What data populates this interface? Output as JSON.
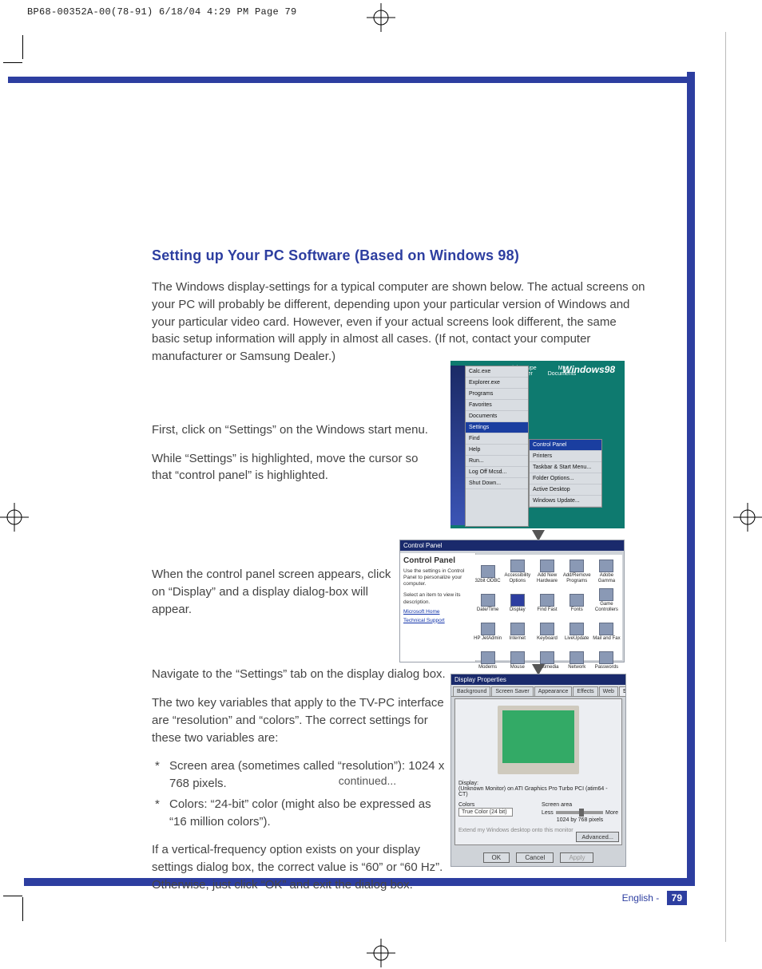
{
  "slug": "BP68-00352A-00(78-91)  6/18/04  4:29 PM  Page 79",
  "title": "Setting up Your PC Software (Based on Windows 98)",
  "intro": "The Windows display-settings for a typical computer are shown below. The actual screens on your PC will probably be different, depending upon your particular version of Windows and your particular video card. However, even if your actual screens look different, the same basic setup information will apply in almost all cases. (If not, contact your computer manufacturer or Samsung Dealer.)",
  "step1a": "First, click on “Settings” on the Windows start menu.",
  "step1b": "While “Settings” is highlighted, move the cursor so that  “control panel” is highlighted.",
  "step2": "When the control panel screen appears, click on “Display” and a display dialog-box will appear.",
  "step3a": "Navigate to the “Settings” tab on the display dialog box.",
  "step3b": "The two key variables that apply to the TV-PC interface are “resolution” and “colors”. The correct settings for these two variables are:",
  "step3_b1": "Screen area (sometimes called “resolution”): 1024 x 768 pixels.",
  "step3_b2": "Colors: “24-bit” color (might also be expressed as “16 million colors”).",
  "step3c": "If a vertical-frequency option exists on your display settings dialog box, the correct value is “60” or “60 Hz”. Otherwise, just click “OK” and exit the dialog box.",
  "continued": "continued...",
  "footer_lang": "English - ",
  "footer_page": "79",
  "startmenu": {
    "os_label": "Windows98",
    "recent_top": [
      "Calc.exe",
      "Explorer.exe"
    ],
    "items": [
      "Programs",
      "Favorites",
      "Documents",
      "Settings",
      "Find",
      "Help",
      "Run...",
      "Log Off Mcsd...",
      "Shut Down..."
    ],
    "settings_sub": [
      "Control Panel",
      "Printers",
      "Taskbar & Start Menu...",
      "Folder Options...",
      "Active Desktop",
      "Windows Update..."
    ],
    "desktop_icons": [
      "Adobe Type Manager",
      "My Documents",
      ""
    ],
    "highlighted": "Settings",
    "sub_highlighted": "Control Panel"
  },
  "control_panel": {
    "title": "Control Panel",
    "side_heading": "Control Panel",
    "side_text": "Use the settings in Control Panel to personalize your computer.",
    "side_hint": "Select an item to view its description.",
    "side_links": [
      "Microsoft Home",
      "Technical Support"
    ],
    "icons": [
      "32bit ODBC",
      "Accessibility Options",
      "Add New Hardware",
      "Add/Remove Programs",
      "Adobe Gamma",
      "Date/Time",
      "Display",
      "Find Fast",
      "Fonts",
      "Game Controllers",
      "HP JetAdmin",
      "Internet",
      "Keyboard",
      "LiveUpdate",
      "Mail and Fax",
      "Modems",
      "Mouse",
      "Multimedia",
      "Network",
      "Passwords"
    ]
  },
  "display_props": {
    "title": "Display Properties",
    "tabs": [
      "Background",
      "Screen Saver",
      "Appearance",
      "Effects",
      "Web",
      "Settings"
    ],
    "active_tab": "Settings",
    "display_label": "Display:",
    "display_value": "(Unknown Monitor) on ATI Graphics Pro Turbo PCI (atim64 - CT)",
    "colors_label": "Colors",
    "colors_value": "True Color (24 bit)",
    "area_label": "Screen area",
    "area_less": "Less",
    "area_more": "More",
    "area_value": "1024 by 768 pixels",
    "extend_label": "Extend my Windows desktop onto this monitor",
    "advanced": "Advanced...",
    "ok": "OK",
    "cancel": "Cancel",
    "apply": "Apply"
  }
}
